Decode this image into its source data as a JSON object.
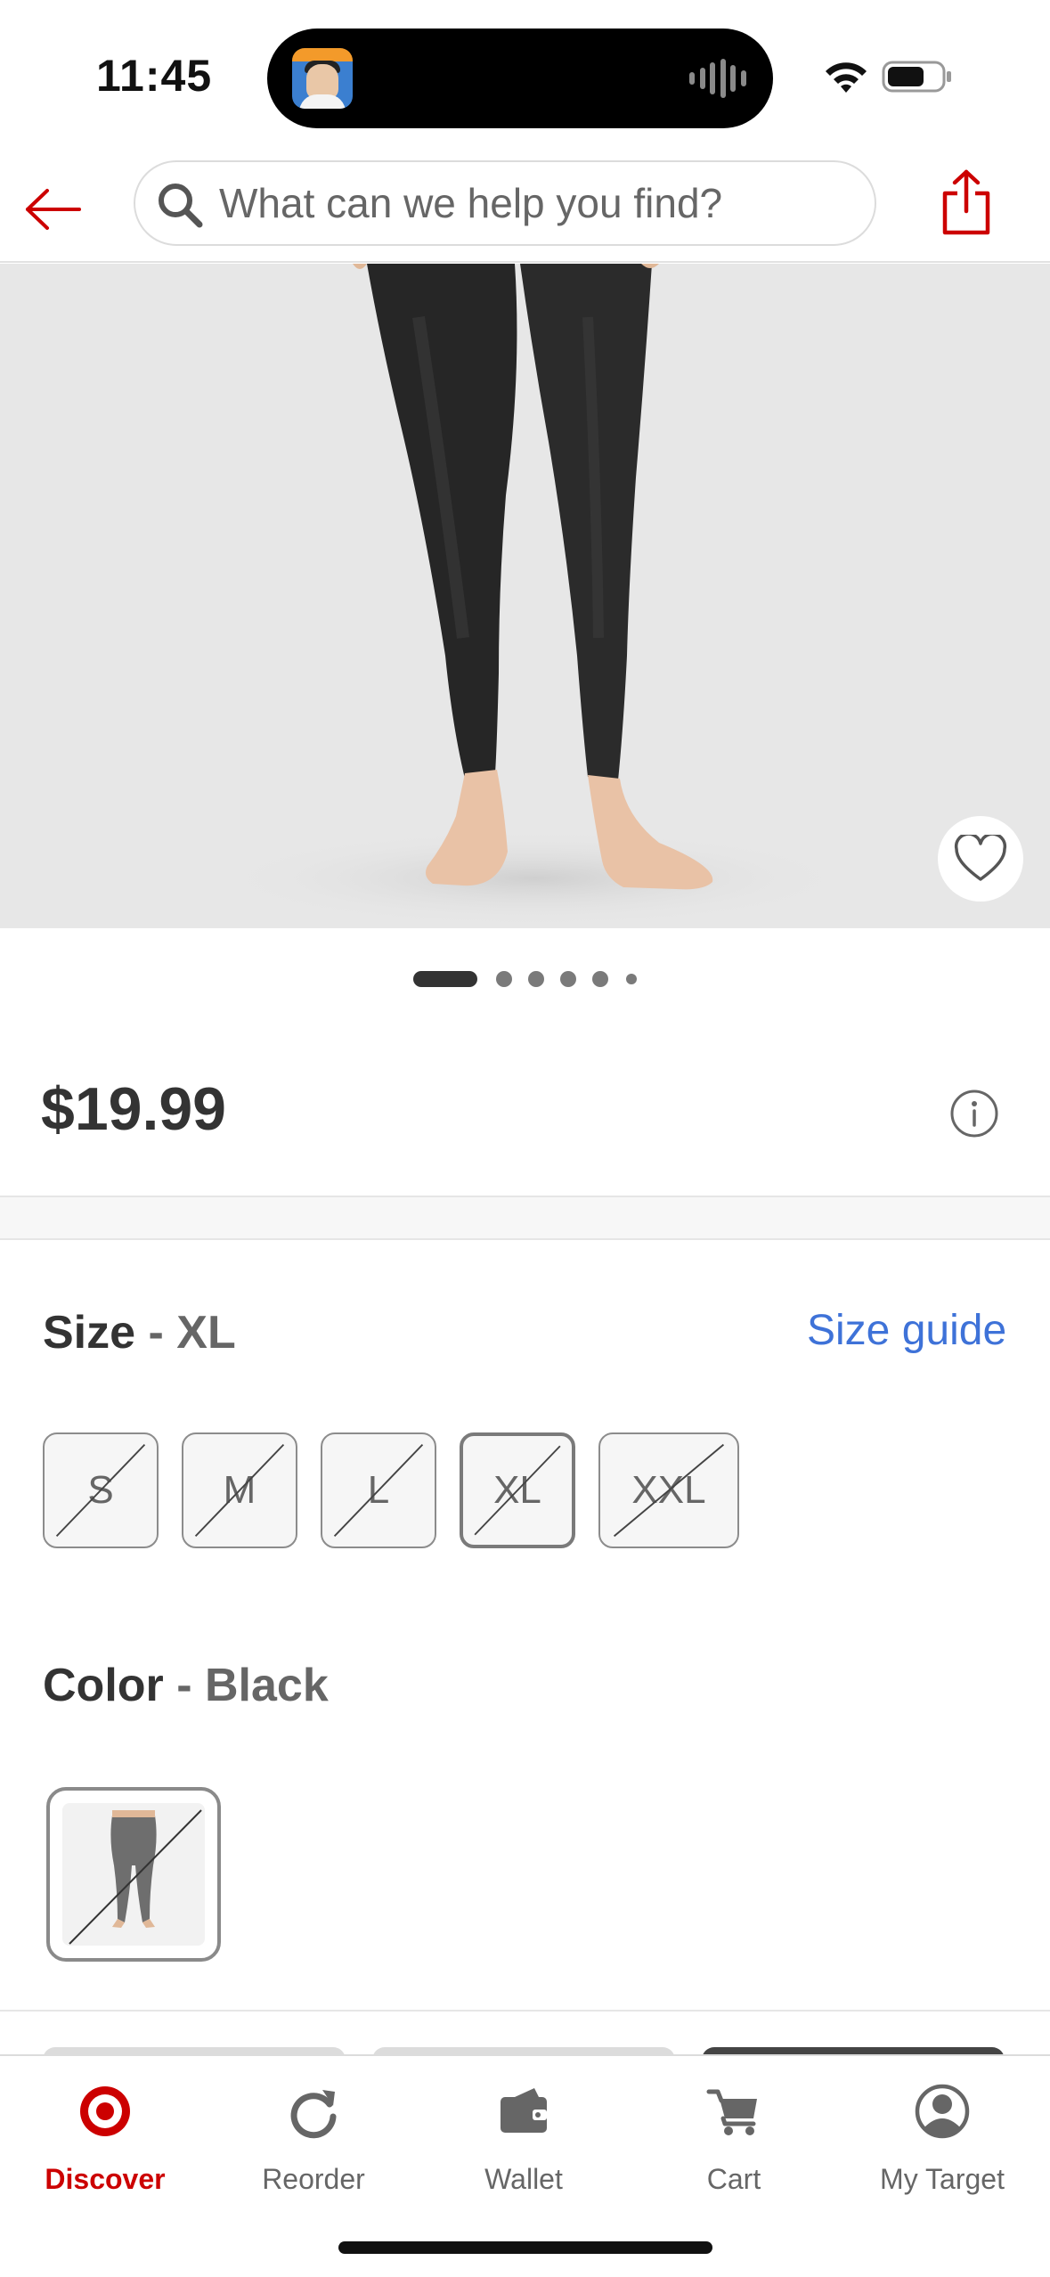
{
  "status_bar": {
    "time": "11:45"
  },
  "header": {
    "search_placeholder": "What can we help you find?"
  },
  "carousel": {
    "total": 6,
    "active_index": 0
  },
  "product": {
    "price": "$19.99"
  },
  "size": {
    "label": "Size",
    "separator": " - ",
    "selected": "XL",
    "guide_label": "Size guide",
    "options": [
      "S",
      "M",
      "L",
      "XL",
      "XXL"
    ]
  },
  "color": {
    "label": "Color",
    "separator": " - ",
    "selected": "Black"
  },
  "tabs": [
    {
      "label": "Discover",
      "icon": "target-logo-icon",
      "active": true
    },
    {
      "label": "Reorder",
      "icon": "reorder-icon",
      "active": false
    },
    {
      "label": "Wallet",
      "icon": "wallet-icon",
      "active": false
    },
    {
      "label": "Cart",
      "icon": "cart-icon",
      "active": false
    },
    {
      "label": "My Target",
      "icon": "account-icon",
      "active": false
    }
  ],
  "colors": {
    "brand_red": "#cc0000",
    "link_blue": "#3e72d8",
    "text_dark": "#333333",
    "text_muted": "#666666"
  }
}
